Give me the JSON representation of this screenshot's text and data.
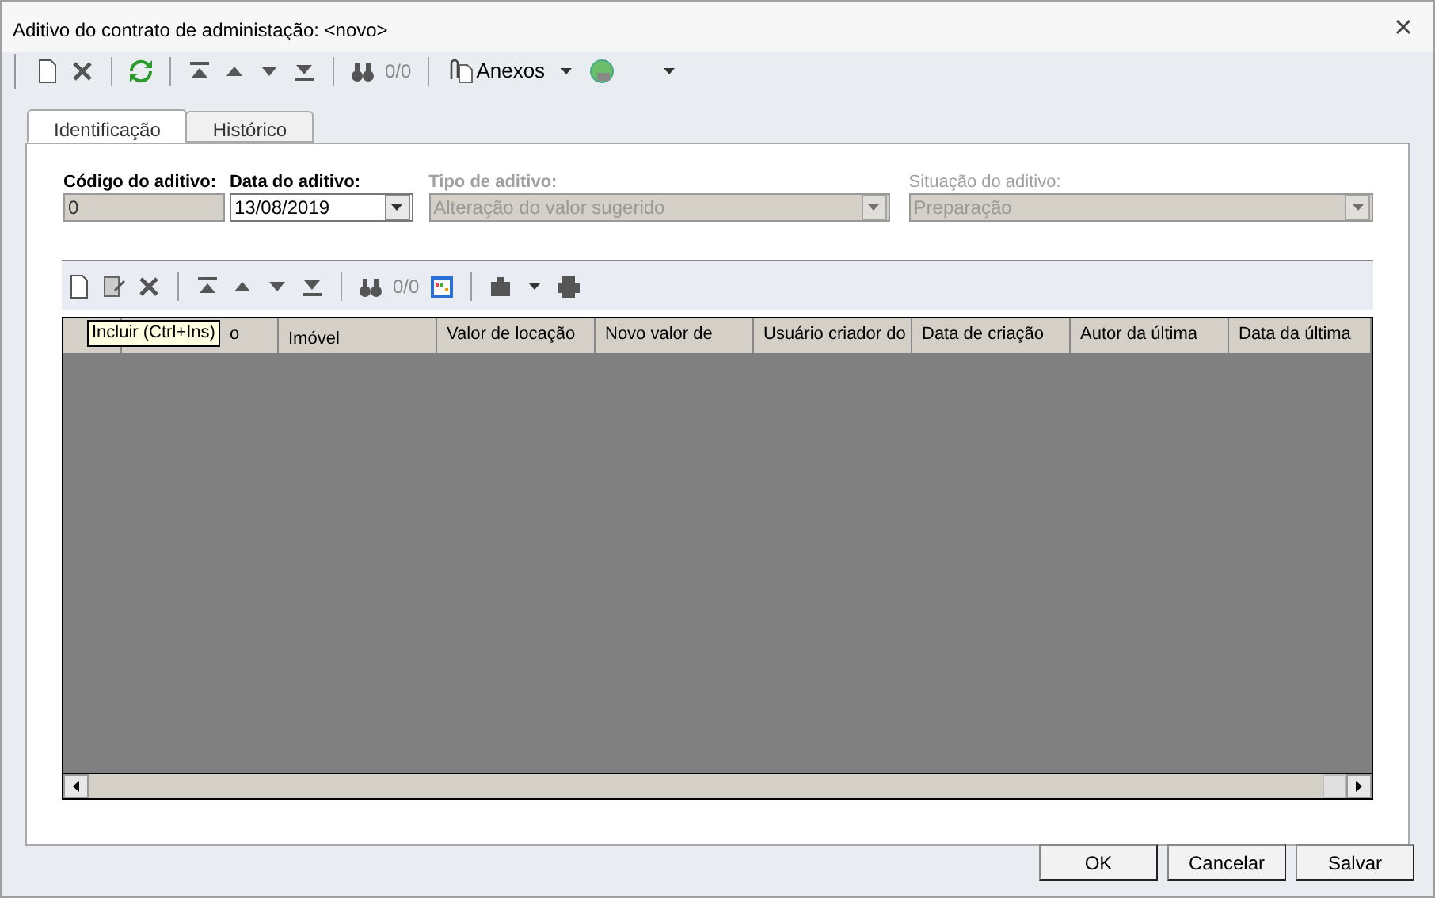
{
  "window": {
    "title": "Aditivo do contrato de administação: <novo>"
  },
  "toolbar": {
    "counter": "0/0",
    "attachments": "Anexos"
  },
  "tabs": [
    {
      "label": "Identificação",
      "selected": true
    },
    {
      "label": "Histórico",
      "selected": false
    }
  ],
  "form": {
    "fields": [
      {
        "label": "Código do aditivo:",
        "value": "0",
        "kind": "text",
        "disabled": true
      },
      {
        "label": "Data do aditivo:",
        "value": "13/08/2019",
        "kind": "date",
        "disabled": false
      },
      {
        "label": "Tipo de aditivo:",
        "value": "Alteração do valor sugerido",
        "kind": "select",
        "disabled": true
      },
      {
        "label": "Situação do aditivo:",
        "value": "Preparação",
        "kind": "select",
        "disabled": true
      }
    ]
  },
  "grid": {
    "counter": "0/0",
    "tooltip": "Incluir (Ctrl+Ins)",
    "columns": [
      "o",
      "Imóvel",
      "Valor de locação",
      "Novo valor de",
      "Usuário criador do",
      "Data de criação",
      "Autor da última",
      "Data da última"
    ]
  },
  "buttons": [
    "OK",
    "Cancelar",
    "Salvar"
  ]
}
